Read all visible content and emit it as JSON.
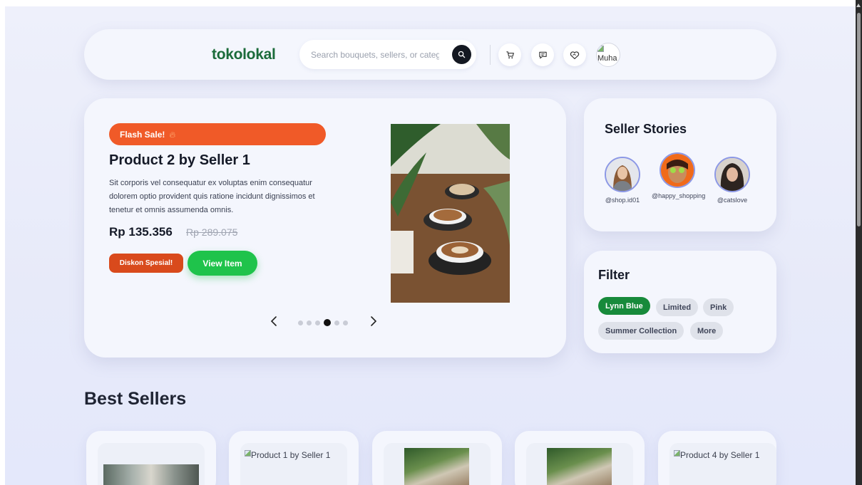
{
  "header": {
    "logo": "tokolokal",
    "search_placeholder": "Search bouquets, sellers, or categories",
    "avatar_alt": "Muha"
  },
  "hero": {
    "badge": "Flash Sale!",
    "badge_icon": "fire-icon",
    "title": "Product 2 by Seller 1",
    "description": "Sit corporis vel consequatur ex voluptas enim consequatur dolorem optio provident quis ratione incidunt dignissimos et tenetur et omnis assumenda omnis.",
    "price": "Rp 135.356",
    "old_price": "Rp 289.075",
    "discount_label": "Diskon Spesial!",
    "view_label": "View Item",
    "slide_count": 6,
    "active_slide": 4,
    "image_alt": "Coffee cups with plants"
  },
  "stories": {
    "title": "Seller Stories",
    "items": [
      {
        "handle": "@shop.id01"
      },
      {
        "handle": "@happy_shopping"
      },
      {
        "handle": "@catslove"
      }
    ]
  },
  "filter": {
    "title": "Filter",
    "chips": [
      "Lynn Blue",
      "Limited",
      "Pink",
      "Summer Collection",
      "More"
    ],
    "active": "Lynn Blue"
  },
  "best_sellers": {
    "title": "Best Sellers",
    "products": [
      {
        "alt": ""
      },
      {
        "alt": "Product 1 by Seller 1"
      },
      {
        "alt": ""
      },
      {
        "alt": ""
      },
      {
        "alt": "Product 4 by Seller 1"
      }
    ]
  },
  "colors": {
    "brand": "#1b6b3a",
    "flash": "#f05a28",
    "discount": "#d94a1c",
    "cta": "#1fc34b",
    "chip_active": "#178a3b"
  }
}
